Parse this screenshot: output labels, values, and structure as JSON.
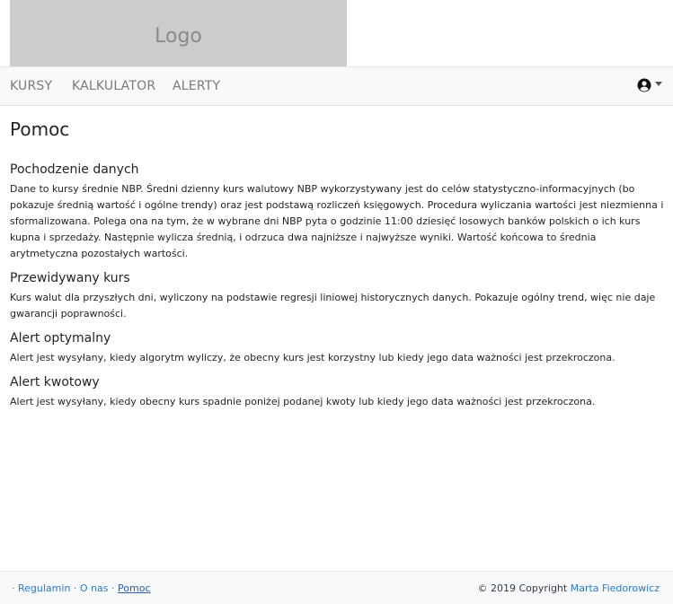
{
  "logo": {
    "text": "Logo"
  },
  "nav": {
    "items": [
      {
        "label": "KURSY"
      },
      {
        "label": "KALKULATOR"
      },
      {
        "label": "ALERTY"
      }
    ],
    "user_icon": "user-circle-icon"
  },
  "page": {
    "title": "Pomoc",
    "sections": [
      {
        "title": "Pochodzenie danych",
        "text": "Dane to kursy średnie NBP. Średni dzienny kurs walutowy NBP wykorzystywany jest do celów statystyczno-informacyjnych (bo pokazuje średnią wartość i ogólne trendy) oraz jest podstawą rozliczeń księgowych. Procedura wyliczania wartości jest niezmienna i sformalizowana. Polega ona na tym, że w wybrane dni NBP pyta o godzinie 11:00 dziesięć losowych banków polskich o ich kurs kupna i sprzedaży. Następnie wylicza średnią, i odrzuca dwa najniższe i najwyższe wyniki. Wartość końcowa to średnia arytmetyczna pozostałych wartości."
      },
      {
        "title": "Przewidywany kurs",
        "text": "Kurs walut dla przyszłych dni, wyliczony na podstawie regresji liniowej historycznych danych. Pokazuje ogólny trend, więc nie daje gwarancji poprawności."
      },
      {
        "title": "Alert optymalny",
        "text": "Alert jest wysyłany, kiedy algorytm wyliczy, że obecny kurs jest korzystny lub kiedy jego data ważności jest przekroczona."
      },
      {
        "title": "Alert kwotowy",
        "text": "Alert jest wysyłany, kiedy obecny kurs spadnie poniżej podanej kwoty lub kiedy jego data ważności jest przekroczona."
      }
    ]
  },
  "footer": {
    "sep": "·",
    "links": [
      {
        "label": "Regulamin"
      },
      {
        "label": "O nas"
      },
      {
        "label": "Pomoc"
      }
    ],
    "copyright": "© 2019 Copyright",
    "author": "Marta Fiedorowicz"
  },
  "colors": {
    "link": "#2a7ad1",
    "navbar_bg": "#f8f9fa",
    "logo_bg": "#cccccc"
  }
}
